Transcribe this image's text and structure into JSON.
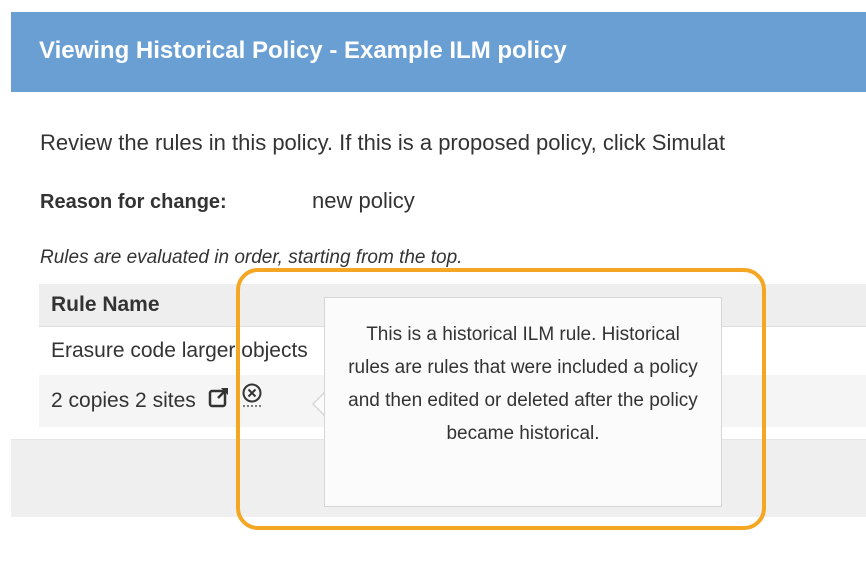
{
  "modal": {
    "title": "Viewing Historical Policy - Example ILM policy",
    "intro": "Review the rules in this policy. If this is a proposed policy, click Simulat",
    "reason_label": "Reason for change:",
    "reason_value": "new policy",
    "order_note": "Rules are evaluated in order, starting from the top."
  },
  "table": {
    "header": "Rule Name",
    "rows": [
      {
        "name": "Erasure code larger objects"
      },
      {
        "name": "2 copies 2 sites",
        "icons": [
          "open-external-icon",
          "historical-rule-icon"
        ]
      }
    ]
  },
  "tooltip": {
    "text": "This is a historical ILM rule. Historical rules are rules that were included a policy and then edited or deleted after the policy became historical."
  },
  "colors": {
    "header_bg": "#6a9fd4",
    "highlight": "#f5a623"
  }
}
